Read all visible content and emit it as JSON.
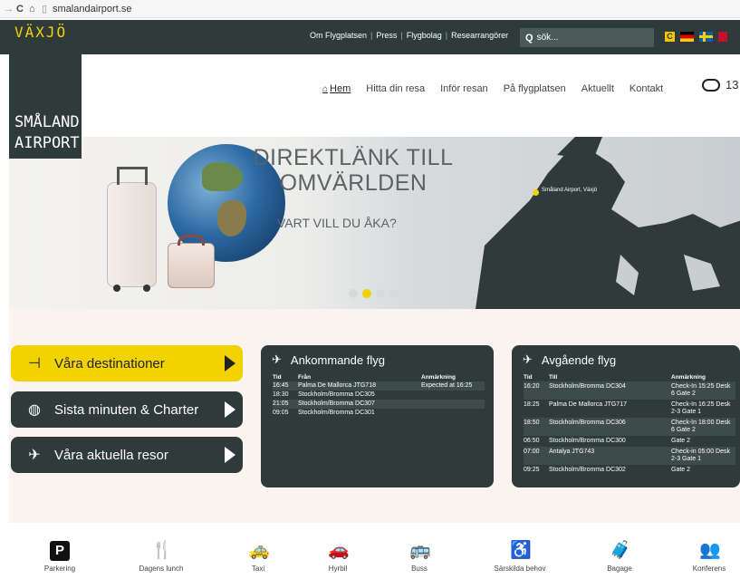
{
  "browser": {
    "url": "smalandairport.se"
  },
  "topbar": {
    "links": [
      "Om Flygplatsen",
      "Press",
      "Flygbolag",
      "Researrangörer"
    ],
    "search_placeholder": "sök...",
    "language_flags": [
      "C",
      "de",
      "se",
      "uk"
    ]
  },
  "logo": {
    "city": "VÄXJÖ",
    "line1": "SMÅLAND",
    "line2": "AIRPORT"
  },
  "nav": {
    "items": [
      "Hem",
      "Hitta din resa",
      "Inför resan",
      "På flygplatsen",
      "Aktuellt",
      "Kontakt"
    ],
    "weather_temp": "13"
  },
  "hero": {
    "title_line1": "DIREKTLÄNK TILL",
    "title_line2": "OMVÄRLDEN",
    "subtitle": "VART VILL DU ÅKA?",
    "pin_label": "Småland Airport, Växjö",
    "slides": 4,
    "active_slide": 2
  },
  "buttons": {
    "destinations": "Våra destinationer",
    "last_minute": "Sista minuten & Charter",
    "current_trips": "Våra aktuella resor"
  },
  "arrivals": {
    "title": "Ankommande flyg",
    "headers": [
      "Tid",
      "Från",
      "Anmärkning"
    ],
    "rows": [
      [
        "16:45",
        "Palma De Mallorca JTG718",
        "Expected at 16:25"
      ],
      [
        "18:30",
        "Stockholm/Bromma DC305",
        ""
      ],
      [
        "21:05",
        "Stockholm/Bromma DC307",
        ""
      ],
      [
        "09:05",
        "Stockholm/Bromma DC301",
        ""
      ]
    ]
  },
  "departures": {
    "title": "Avgående flyg",
    "headers": [
      "Tid",
      "Till",
      "Anmärkning"
    ],
    "rows": [
      [
        "16:20",
        "Stockholm/Bromma DC304",
        "Check-In 15:25 Desk 6 Gate 2"
      ],
      [
        "18:25",
        "Palma De Mallorca JTG717",
        "Check-In 16:25 Desk 2-3 Gate 1"
      ],
      [
        "18:50",
        "Stockholm/Bromma DC306",
        "Check-In 18:00 Desk 6 Gate 2"
      ],
      [
        "06:50",
        "Stockholm/Bromma DC300",
        "Gate 2"
      ],
      [
        "07:00",
        "Antalya JTG743",
        "Check-in 05:00 Desk 2-3 Gate 1"
      ],
      [
        "09:25",
        "Stockholm/Bromma DC302",
        "Gate 2"
      ]
    ]
  },
  "amenities": [
    {
      "label": "Parkering",
      "icon": "parking-icon"
    },
    {
      "label": "Dagens lunch",
      "icon": "fork-knife-icon"
    },
    {
      "label": "Taxi",
      "icon": "taxi-icon"
    },
    {
      "label": "Hyrbil",
      "icon": "car-icon"
    },
    {
      "label": "Buss",
      "icon": "bus-icon"
    },
    {
      "label": "Särskilda behov",
      "icon": "wheelchair-icon"
    },
    {
      "label": "Bagage",
      "icon": "baggage-icon"
    },
    {
      "label": "Konferens",
      "icon": "conference-icon"
    }
  ],
  "colors": {
    "dark": "#2e3b3a",
    "accent": "#f2d300",
    "background": "#fbf3ef"
  }
}
